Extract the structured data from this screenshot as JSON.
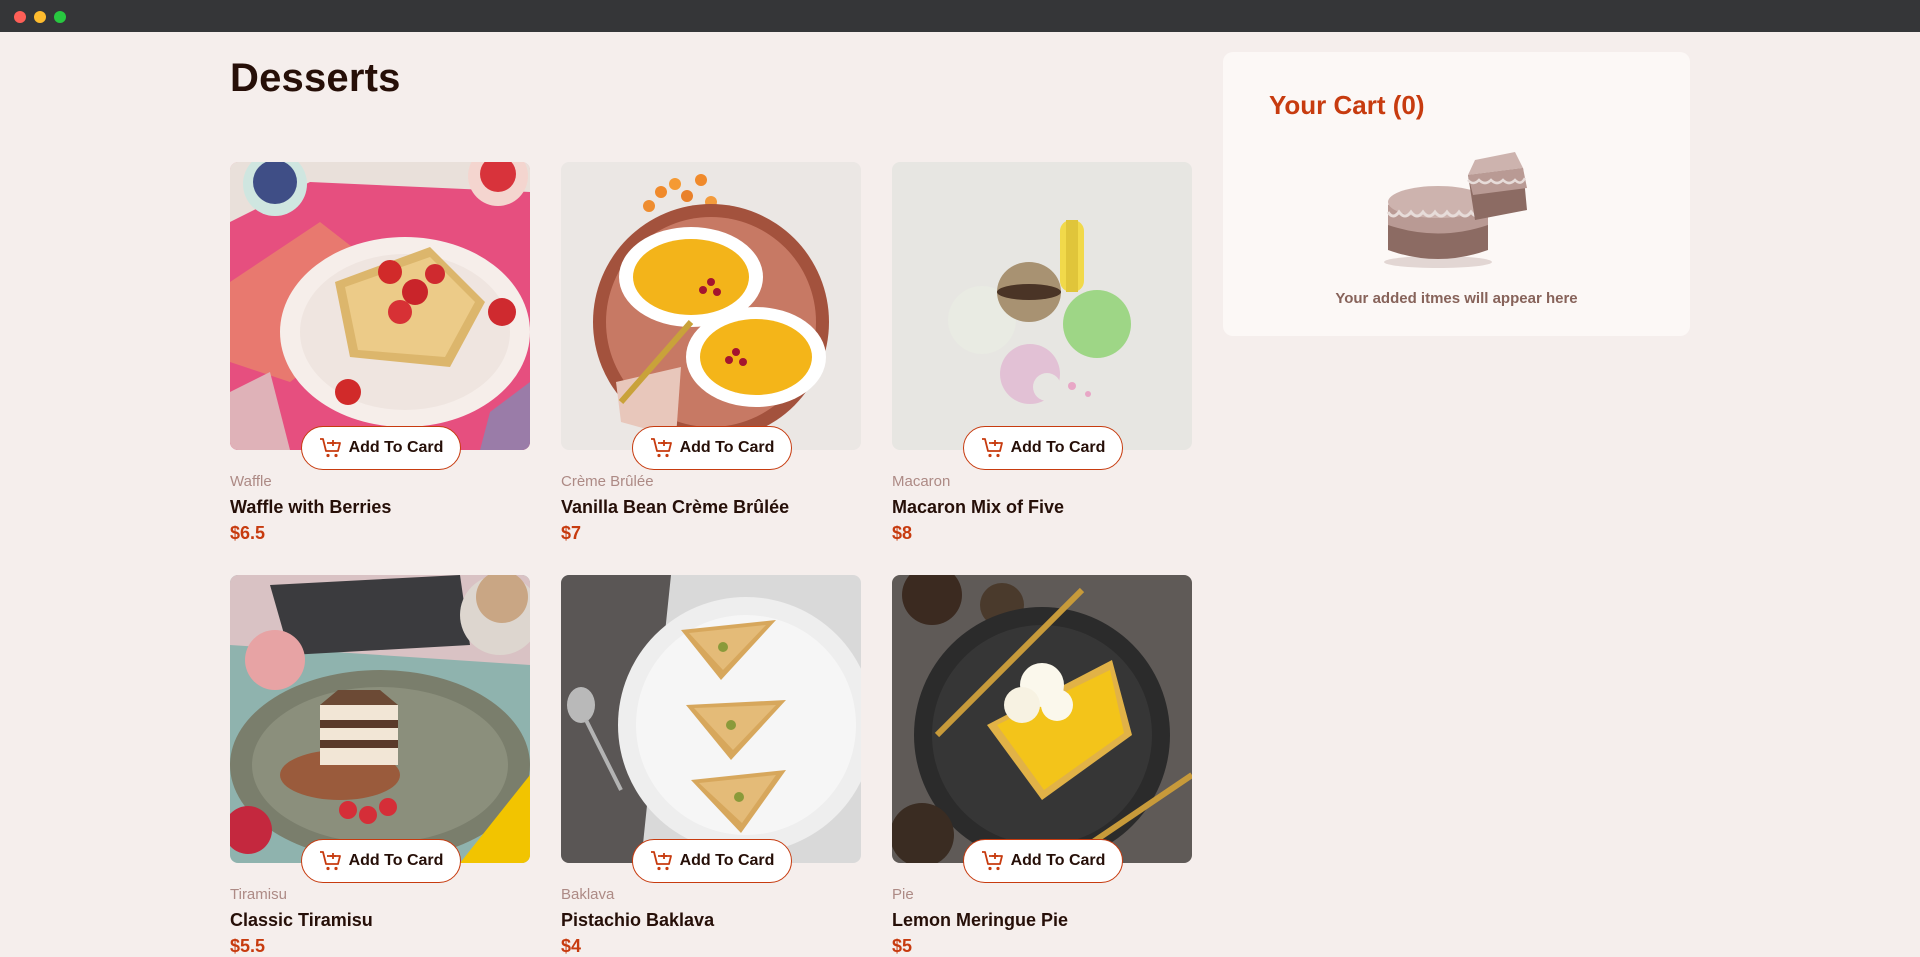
{
  "page": {
    "title": "Desserts"
  },
  "products": [
    {
      "category": "Waffle",
      "name": "Waffle with Berries",
      "price": "$6.5",
      "button": "Add To Card"
    },
    {
      "category": "Crème Brûlée",
      "name": "Vanilla Bean Crème Brûlée",
      "price": "$7",
      "button": "Add To Card"
    },
    {
      "category": "Macaron",
      "name": "Macaron Mix of Five",
      "price": "$8",
      "button": "Add To Card"
    },
    {
      "category": "Tiramisu",
      "name": "Classic Tiramisu",
      "price": "$5.5",
      "button": "Add To Card"
    },
    {
      "category": "Baklava",
      "name": "Pistachio Baklava",
      "price": "$4",
      "button": "Add To Card"
    },
    {
      "category": "Pie",
      "name": "Lemon Meringue Pie",
      "price": "$5",
      "button": "Add To Card"
    }
  ],
  "cart": {
    "title": "Your Cart (0)",
    "empty_message": "Your added itmes will appear here"
  },
  "icons": {
    "add_to_cart": "cart-plus-icon",
    "empty_cart": "cake-illustration"
  },
  "colors": {
    "accent": "#c73b0f",
    "background": "#f5eeec",
    "text": "#260f08",
    "muted": "#ad8a85"
  }
}
